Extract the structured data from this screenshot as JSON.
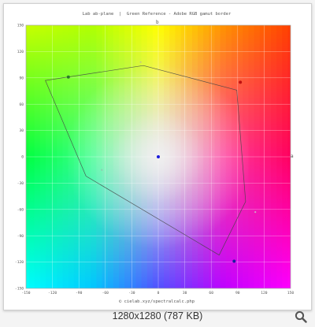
{
  "viewer": {
    "caption": "1280x1280 (787 KB)",
    "zoom_icon": "magnifier-icon"
  },
  "chart_data": {
    "type": "scatter",
    "title": "Lab ab-plane  |  Green Reference - Adobe RGB gamut border",
    "xlabel": "a",
    "ylabel": "b",
    "credit": "© cielab.xyz/spectralcalc.php",
    "xlim": [
      -150,
      150
    ],
    "ylim": [
      -150,
      150
    ],
    "x_ticks": [
      -150,
      -120,
      -90,
      -60,
      -30,
      0,
      30,
      60,
      90,
      120,
      150
    ],
    "y_ticks": [
      150,
      120,
      90,
      60,
      30,
      0,
      -30,
      -60,
      -90,
      -120,
      -150
    ],
    "grid": true,
    "background": "ab-plane hue/chroma color wheel",
    "gamut_border": {
      "name": "Adobe RGB gamut border",
      "color": "#444444",
      "points": [
        [
          -128,
          87
        ],
        [
          -17,
          104
        ],
        [
          89,
          76
        ],
        [
          99,
          -51
        ],
        [
          69,
          -112
        ],
        [
          -82,
          -22
        ]
      ]
    },
    "points": [
      {
        "a": 0,
        "b": 0,
        "color": "#1a1adb"
      },
      {
        "a": -102,
        "b": 91,
        "color": "#2a7a2a"
      },
      {
        "a": 93,
        "b": 85,
        "color": "#c01010"
      },
      {
        "a": 86,
        "b": -119,
        "color": "#1a1aa0"
      },
      {
        "a": -20,
        "b": 108,
        "color": "#c8c880"
      },
      {
        "a": -64,
        "b": -15,
        "color": "#90c8b0"
      },
      {
        "a": 110,
        "b": -63,
        "color": "#d0a0c8"
      }
    ]
  }
}
